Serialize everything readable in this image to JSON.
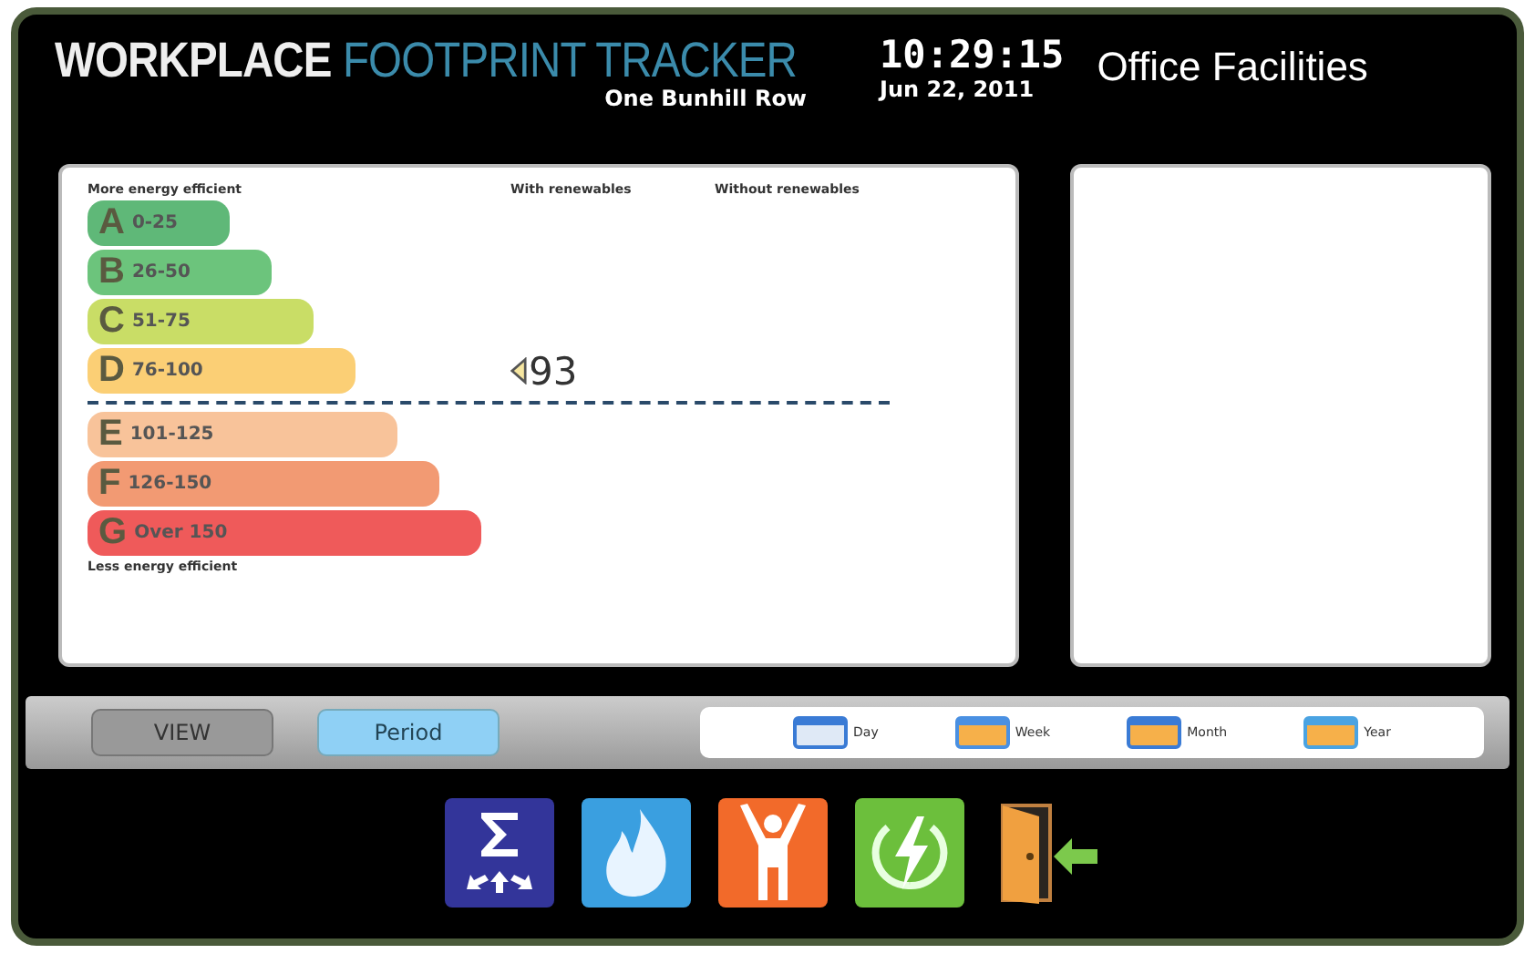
{
  "header": {
    "title_main": "WORKPLACE",
    "title_accent": "FOOTPRINT TRACKER",
    "location": "One Bunhill Row",
    "time": "10:29:15",
    "date": "Jun 22, 2011",
    "brand": "Office Facilities"
  },
  "rating_panel": {
    "top_label": "More energy efficient",
    "bottom_label": "Less energy efficient",
    "columns": [
      "With renewables",
      "Without renewables"
    ],
    "bands": [
      {
        "letter": "A",
        "range": "0-25",
        "color": "#5fb878",
        "divider_below": false
      },
      {
        "letter": "B",
        "range": "26-50",
        "color": "#6cc47c",
        "divider_below": false
      },
      {
        "letter": "C",
        "range": "51-75",
        "color": "#c9dd66",
        "divider_below": false
      },
      {
        "letter": "D",
        "range": "76-100",
        "color": "#fbcf75",
        "with_renewables": "93",
        "divider_below": true
      },
      {
        "letter": "E",
        "range": "101-125",
        "color": "#f8c39a",
        "divider_below": false
      },
      {
        "letter": "F",
        "range": "126-150",
        "color": "#f29a73",
        "divider_below": false
      },
      {
        "letter": "G",
        "range": "Over 150",
        "color": "#ef5a5a",
        "divider_below": false
      }
    ]
  },
  "toolbar": {
    "buttons": [
      {
        "label": "VIEW",
        "selected": false
      },
      {
        "label": "Period",
        "selected": true
      }
    ],
    "periods": [
      {
        "label": "Day",
        "kind": "day"
      },
      {
        "label": "Week",
        "kind": "week"
      },
      {
        "label": "Month",
        "kind": "month"
      },
      {
        "label": "Year",
        "kind": "year"
      }
    ]
  },
  "nav": [
    {
      "kind": "sum"
    },
    {
      "kind": "fire"
    },
    {
      "kind": "person"
    },
    {
      "kind": "power"
    },
    {
      "kind": "exit"
    }
  ]
}
